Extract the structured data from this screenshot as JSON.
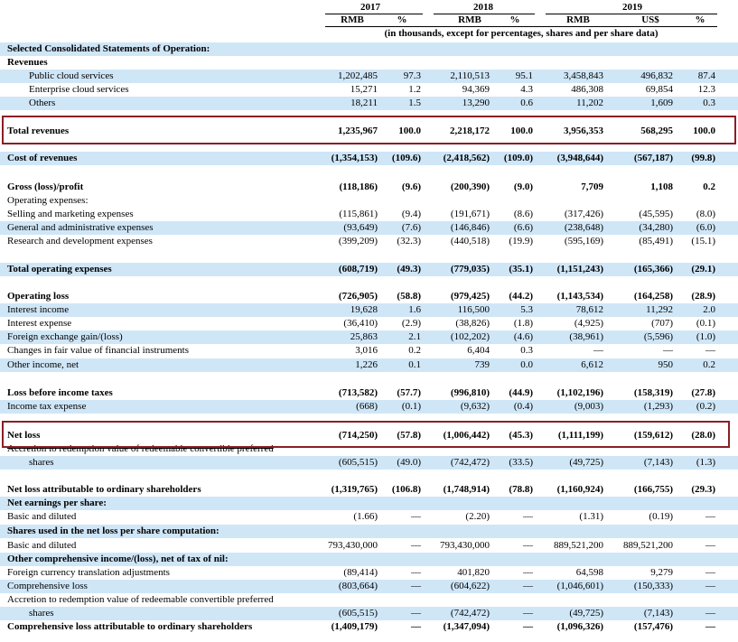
{
  "header": {
    "years": [
      "2017",
      "2018",
      "2019"
    ],
    "currency_cols": [
      "RMB",
      "%",
      "RMB",
      "%",
      "RMB",
      "US$",
      "%"
    ],
    "note": "(in thousands, except for percentages, shares and per share data)"
  },
  "rows": [
    {
      "label": "Selected Consolidated Statements of Operation:",
      "style": "bold",
      "bg": "sec",
      "v": [
        "",
        "",
        "",
        "",
        "",
        "",
        ""
      ]
    },
    {
      "label": "Revenues",
      "style": "bold",
      "bg": "",
      "v": [
        "",
        "",
        "",
        "",
        "",
        "",
        ""
      ]
    },
    {
      "label": "Public cloud services",
      "style": "indent",
      "bg": "alt",
      "v": [
        "1,202,485",
        "97.3",
        "2,110,513",
        "95.1",
        "3,458,843",
        "496,832",
        "87.4"
      ]
    },
    {
      "label": "Enterprise cloud services",
      "style": "indent",
      "bg": "",
      "v": [
        "15,271",
        "1.2",
        "94,369",
        "4.3",
        "486,308",
        "69,854",
        "12.3"
      ]
    },
    {
      "label": "Others",
      "style": "indent",
      "bg": "alt",
      "v": [
        "18,211",
        "1.5",
        "13,290",
        "0.6",
        "11,202",
        "1,609",
        "0.3"
      ]
    },
    {
      "label": "Total revenues",
      "style": "bold",
      "bg": "",
      "v": [
        "1,235,967",
        "100.0",
        "2,218,172",
        "100.0",
        "3,956,353",
        "568,295",
        "100.0"
      ]
    },
    {
      "label": "Cost of revenues",
      "style": "bold",
      "bg": "alt",
      "v": [
        "(1,354,153)",
        "(109.6)",
        "(2,418,562)",
        "(109.0)",
        "(3,948,644)",
        "(567,187)",
        "(99.8)"
      ]
    },
    {
      "label": "Gross (loss)/profit",
      "style": "bold",
      "bg": "",
      "v": [
        "(118,186)",
        "(9.6)",
        "(200,390)",
        "(9.0)",
        "7,709",
        "1,108",
        "0.2"
      ]
    },
    {
      "label": "Operating expenses:",
      "style": "",
      "bg": "",
      "v": [
        "",
        "",
        "",
        "",
        "",
        "",
        ""
      ]
    },
    {
      "label": "Selling and marketing expenses",
      "style": "",
      "bg": "",
      "v": [
        "(115,861)",
        "(9.4)",
        "(191,671)",
        "(8.6)",
        "(317,426)",
        "(45,595)",
        "(8.0)"
      ]
    },
    {
      "label": "General and administrative expenses",
      "style": "",
      "bg": "alt",
      "v": [
        "(93,649)",
        "(7.6)",
        "(146,846)",
        "(6.6)",
        "(238,648)",
        "(34,280)",
        "(6.0)"
      ]
    },
    {
      "label": "Research and development expenses",
      "style": "",
      "bg": "",
      "v": [
        "(399,209)",
        "(32.3)",
        "(440,518)",
        "(19.9)",
        "(595,169)",
        "(85,491)",
        "(15.1)"
      ]
    },
    {
      "label": "Total operating expenses",
      "style": "bold",
      "bg": "alt",
      "v": [
        "(608,719)",
        "(49.3)",
        "(779,035)",
        "(35.1)",
        "(1,151,243)",
        "(165,366)",
        "(29.1)"
      ]
    },
    {
      "label": "Operating loss",
      "style": "bold",
      "bg": "",
      "v": [
        "(726,905)",
        "(58.8)",
        "(979,425)",
        "(44.2)",
        "(1,143,534)",
        "(164,258)",
        "(28.9)"
      ]
    },
    {
      "label": "Interest income",
      "style": "",
      "bg": "alt",
      "v": [
        "19,628",
        "1.6",
        "116,500",
        "5.3",
        "78,612",
        "11,292",
        "2.0"
      ]
    },
    {
      "label": "Interest expense",
      "style": "",
      "bg": "",
      "v": [
        "(36,410)",
        "(2.9)",
        "(38,826)",
        "(1.8)",
        "(4,925)",
        "(707)",
        "(0.1)"
      ]
    },
    {
      "label": "Foreign exchange gain/(loss)",
      "style": "",
      "bg": "alt",
      "v": [
        "25,863",
        "2.1",
        "(102,202)",
        "(4.6)",
        "(38,961)",
        "(5,596)",
        "(1.0)"
      ]
    },
    {
      "label": "Changes in fair value of financial instruments",
      "style": "",
      "bg": "",
      "v": [
        "3,016",
        "0.2",
        "6,404",
        "0.3",
        "—",
        "—",
        "—"
      ]
    },
    {
      "label": "Other income, net",
      "style": "",
      "bg": "alt",
      "v": [
        "1,226",
        "0.1",
        "739",
        "0.0",
        "6,612",
        "950",
        "0.2"
      ]
    },
    {
      "label": "Loss before income taxes",
      "style": "bold",
      "bg": "",
      "v": [
        "(713,582)",
        "(57.7)",
        "(996,810)",
        "(44.9)",
        "(1,102,196)",
        "(158,319)",
        "(27.8)"
      ]
    },
    {
      "label": "Income tax expense",
      "style": "",
      "bg": "alt",
      "v": [
        "(668)",
        "(0.1)",
        "(9,632)",
        "(0.4)",
        "(9,003)",
        "(1,293)",
        "(0.2)"
      ]
    },
    {
      "label": "Net loss",
      "style": "bold",
      "bg": "",
      "v": [
        "(714,250)",
        "(57.8)",
        "(1,006,442)",
        "(45.3)",
        "(1,111,199)",
        "(159,612)",
        "(28.0)"
      ]
    },
    {
      "label": "Accretion to redemption value of redeemable convertible preferred",
      "style": "strike",
      "bg": "",
      "v": [
        "",
        "",
        "",
        "",
        "",
        "",
        ""
      ]
    },
    {
      "label": "shares",
      "style": "indent",
      "bg": "alt",
      "v": [
        "(605,515)",
        "(49.0)",
        "(742,472)",
        "(33.5)",
        "(49,725)",
        "(7,143)",
        "(1.3)"
      ]
    },
    {
      "label": "Net loss attributable to ordinary shareholders",
      "style": "bold",
      "bg": "",
      "v": [
        "(1,319,765)",
        "(106.8)",
        "(1,748,914)",
        "(78.8)",
        "(1,160,924)",
        "(166,755)",
        "(29.3)"
      ]
    },
    {
      "label": "Net earnings per share:",
      "style": "bold",
      "bg": "alt",
      "v": [
        "",
        "",
        "",
        "",
        "",
        "",
        ""
      ]
    },
    {
      "label": "Basic and diluted",
      "style": "",
      "bg": "",
      "v": [
        "(1.66)",
        "—",
        "(2.20)",
        "—",
        "(1.31)",
        "(0.19)",
        "—"
      ]
    },
    {
      "label": "Shares used in the net loss per share computation:",
      "style": "bold",
      "bg": "alt",
      "v": [
        "",
        "",
        "",
        "",
        "",
        "",
        ""
      ]
    },
    {
      "label": "Basic and diluted",
      "style": "",
      "bg": "",
      "v": [
        "793,430,000",
        "—",
        "793,430,000",
        "—",
        "889,521,200",
        "889,521,200",
        "—"
      ]
    },
    {
      "label": "Other comprehensive income/(loss), net of tax of nil:",
      "style": "bold",
      "bg": "alt",
      "v": [
        "",
        "",
        "",
        "",
        "",
        "",
        ""
      ]
    },
    {
      "label": "Foreign currency translation adjustments",
      "style": "",
      "bg": "",
      "v": [
        "(89,414)",
        "—",
        "401,820",
        "—",
        "64,598",
        "9,279",
        "—"
      ]
    },
    {
      "label": "Comprehensive loss",
      "style": "",
      "bg": "alt",
      "v": [
        "(803,664)",
        "—",
        "(604,622)",
        "—",
        "(1,046,601)",
        "(150,333)",
        "—"
      ]
    },
    {
      "label": "Accretion to redemption value of redeemable convertible preferred",
      "style": "",
      "bg": "",
      "v": [
        "",
        "",
        "",
        "",
        "",
        "",
        ""
      ]
    },
    {
      "label": "shares",
      "style": "indent",
      "bg": "alt",
      "v": [
        "(605,515)",
        "—",
        "(742,472)",
        "—",
        "(49,725)",
        "(7,143)",
        "—"
      ]
    },
    {
      "label": "Comprehensive loss attributable to ordinary shareholders",
      "style": "bold",
      "bg": "",
      "v": [
        "(1,409,179)",
        "—",
        "(1,347,094)",
        "—",
        "(1,096,326)",
        "(157,476)",
        "—"
      ]
    }
  ]
}
